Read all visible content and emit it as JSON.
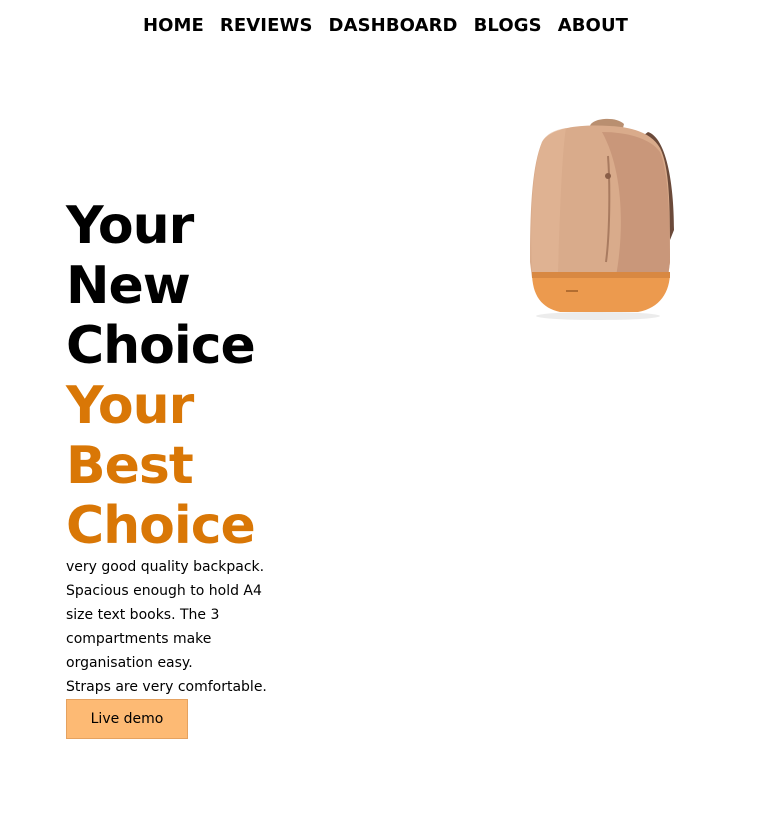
{
  "nav": {
    "items": [
      {
        "label": "HOME"
      },
      {
        "label": "REVIEWS"
      },
      {
        "label": "DASHBOARD"
      },
      {
        "label": "BLOGS"
      },
      {
        "label": "ABOUT"
      }
    ]
  },
  "hero": {
    "headline_black": [
      "Your",
      "New",
      "Choice"
    ],
    "headline_orange": [
      "Your",
      "Best",
      "Choice"
    ],
    "description": "very good quality backpack. Spacious enough to hold A4 size text books. The 3 compartments make organisation easy.\nStraps are very comfortable.",
    "cta_label": "Live demo"
  },
  "product": {
    "icon": "backpack-image"
  },
  "colors": {
    "accent_text": "#d97706",
    "cta_background": "#fdba74"
  }
}
